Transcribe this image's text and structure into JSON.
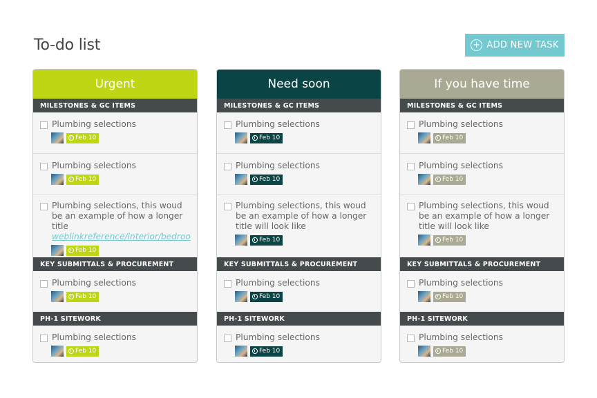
{
  "page": {
    "title": "To-do list"
  },
  "add_button": {
    "label": "ADD NEW TASK",
    "icon": "plus-circle-icon"
  },
  "colors": {
    "accent": "#74c8cf",
    "section_header": "#454a4d",
    "urgent": "#bed613",
    "need_soon": "#0a4445",
    "if_time": "#aaa993"
  },
  "columns": [
    {
      "title": "Urgent",
      "color": "#bed613",
      "sections": [
        {
          "title": "MILESTONES & GC ITEMS",
          "tasks": [
            {
              "title": "Plumbing selections",
              "due": "Feb 10"
            },
            {
              "title": "Plumbing selections",
              "due": "Feb 10"
            },
            {
              "title": "Plumbing selections, this woud be an example of how a longer title",
              "link": "weblinkreference/interior/bedroo",
              "due": "Feb 10"
            }
          ]
        },
        {
          "title": "KEY SUBMITTALS & PROCUREMENT",
          "tasks": [
            {
              "title": "Plumbing selections",
              "due": "Feb 10"
            }
          ]
        },
        {
          "title": "PH-1 SITEWORK",
          "tasks": [
            {
              "title": "Plumbing selections",
              "due": "Feb 10"
            }
          ]
        }
      ]
    },
    {
      "title": "Need soon",
      "color": "#0a4445",
      "sections": [
        {
          "title": "MILESTONES & GC ITEMS",
          "tasks": [
            {
              "title": "Plumbing selections",
              "due": "Feb 10"
            },
            {
              "title": "Plumbing selections",
              "due": "Feb 10"
            },
            {
              "title": "Plumbing selections, this woud be an example of how a longer title will look like",
              "due": "Feb 10"
            }
          ]
        },
        {
          "title": "KEY SUBMITTALS & PROCUREMENT",
          "tasks": [
            {
              "title": "Plumbing selections",
              "due": "Feb 10"
            }
          ]
        },
        {
          "title": "PH-1 SITEWORK",
          "tasks": [
            {
              "title": "Plumbing selections",
              "due": "Feb 10"
            }
          ]
        }
      ]
    },
    {
      "title": "If you have time",
      "color": "#aaa993",
      "sections": [
        {
          "title": "MILESTONES & GC ITEMS",
          "tasks": [
            {
              "title": "Plumbing selections",
              "due": "Feb 10"
            },
            {
              "title": "Plumbing selections",
              "due": "Feb 10"
            },
            {
              "title": "Plumbing selections, this woud be an example of how a longer title will look like",
              "due": "Feb 10"
            }
          ]
        },
        {
          "title": "KEY SUBMITTALS & PROCUREMENT",
          "tasks": [
            {
              "title": "Plumbing selections",
              "due": "Feb 10"
            }
          ]
        },
        {
          "title": "PH-1 SITEWORK",
          "tasks": [
            {
              "title": "Plumbing selections",
              "due": "Feb 10"
            }
          ]
        }
      ]
    }
  ]
}
